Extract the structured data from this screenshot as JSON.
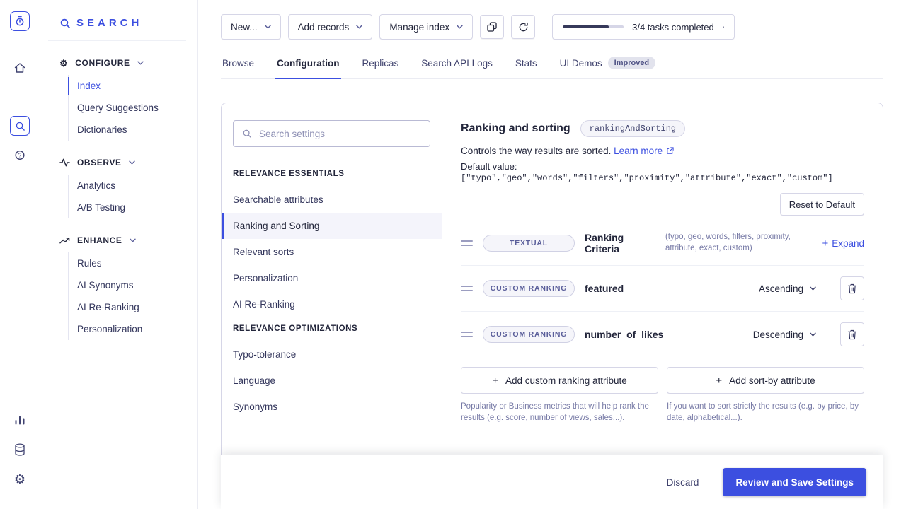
{
  "sidebar": {
    "brand": "SEARCH",
    "sections": [
      {
        "label": "CONFIGURE",
        "items": [
          {
            "label": "Index",
            "active": true
          },
          {
            "label": "Query Suggestions"
          },
          {
            "label": "Dictionaries"
          }
        ]
      },
      {
        "label": "OBSERVE",
        "items": [
          {
            "label": "Analytics"
          },
          {
            "label": "A/B Testing"
          }
        ]
      },
      {
        "label": "ENHANCE",
        "items": [
          {
            "label": "Rules"
          },
          {
            "label": "AI Synonyms"
          },
          {
            "label": "AI Re-Ranking"
          },
          {
            "label": "Personalization"
          }
        ]
      }
    ]
  },
  "toolbar": {
    "buttons": [
      {
        "label": "New..."
      },
      {
        "label": "Add records"
      },
      {
        "label": "Manage index"
      }
    ],
    "progress": {
      "label": "3/4 tasks completed",
      "percent": 75
    }
  },
  "tabs": {
    "items": [
      {
        "label": "Browse"
      },
      {
        "label": "Configuration",
        "active": true
      },
      {
        "label": "Replicas"
      },
      {
        "label": "Search API Logs"
      },
      {
        "label": "Stats"
      },
      {
        "label": "UI Demos",
        "badge": "Improved"
      }
    ]
  },
  "settings_nav": {
    "search_placeholder": "Search settings",
    "groups": [
      {
        "header": "RELEVANCE ESSENTIALS",
        "items": [
          {
            "label": "Searchable attributes"
          },
          {
            "label": "Ranking and Sorting",
            "active": true
          },
          {
            "label": "Relevant sorts"
          },
          {
            "label": "Personalization"
          },
          {
            "label": "AI Re-Ranking"
          }
        ]
      },
      {
        "header": "RELEVANCE OPTIMIZATIONS",
        "items": [
          {
            "label": "Typo-tolerance"
          },
          {
            "label": "Language"
          },
          {
            "label": "Synonyms"
          }
        ]
      }
    ]
  },
  "panel": {
    "title": "Ranking and sorting",
    "api_name": "rankingAndSorting",
    "description": "Controls the way results are sorted.",
    "learn_more": "Learn more",
    "default_label": "Default value:",
    "default_value": "[\"typo\",\"geo\",\"words\",\"filters\",\"proximity\",\"attribute\",\"exact\",\"custom\"]",
    "reset_button": "Reset to Default",
    "rows": [
      {
        "tag": "TEXTUAL",
        "label": "Ranking Criteria",
        "note": "(typo, geo, words, filters, proximity, attribute, exact, custom)",
        "expand": "Expand"
      },
      {
        "tag": "CUSTOM RANKING",
        "label": "featured",
        "direction": "Ascending"
      },
      {
        "tag": "CUSTOM RANKING",
        "label": "number_of_likes",
        "direction": "Descending"
      }
    ],
    "add_custom_button": "Add custom ranking attribute",
    "add_sort_button": "Add sort-by attribute",
    "custom_help": "Popularity or Business metrics that will help rank the results (e.g. score, number of views, sales...).",
    "sort_help": "If you want to sort strictly the results (e.g. by price, by date, alphabetical...)."
  },
  "footer": {
    "discard": "Discard",
    "save": "Review and Save Settings"
  }
}
